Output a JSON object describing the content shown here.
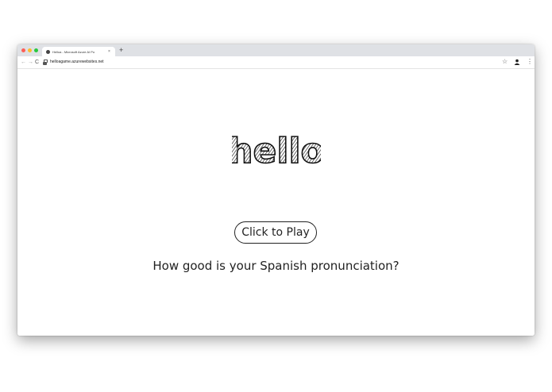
{
  "browser": {
    "tab_title": "Helloa - Microsoft Azure AI Po",
    "new_tab_label": "+",
    "tab_close_label": "×",
    "url": "helloagame.azurewebsites.net",
    "nav": {
      "back": "←",
      "forward": "→",
      "reload": "C"
    },
    "bookmark_icon": "star-icon",
    "menu_label": "⋮"
  },
  "page": {
    "logo_text": "hello",
    "play_button_label": "Click to Play",
    "tagline": "How good is your Spanish pronunciation?"
  }
}
